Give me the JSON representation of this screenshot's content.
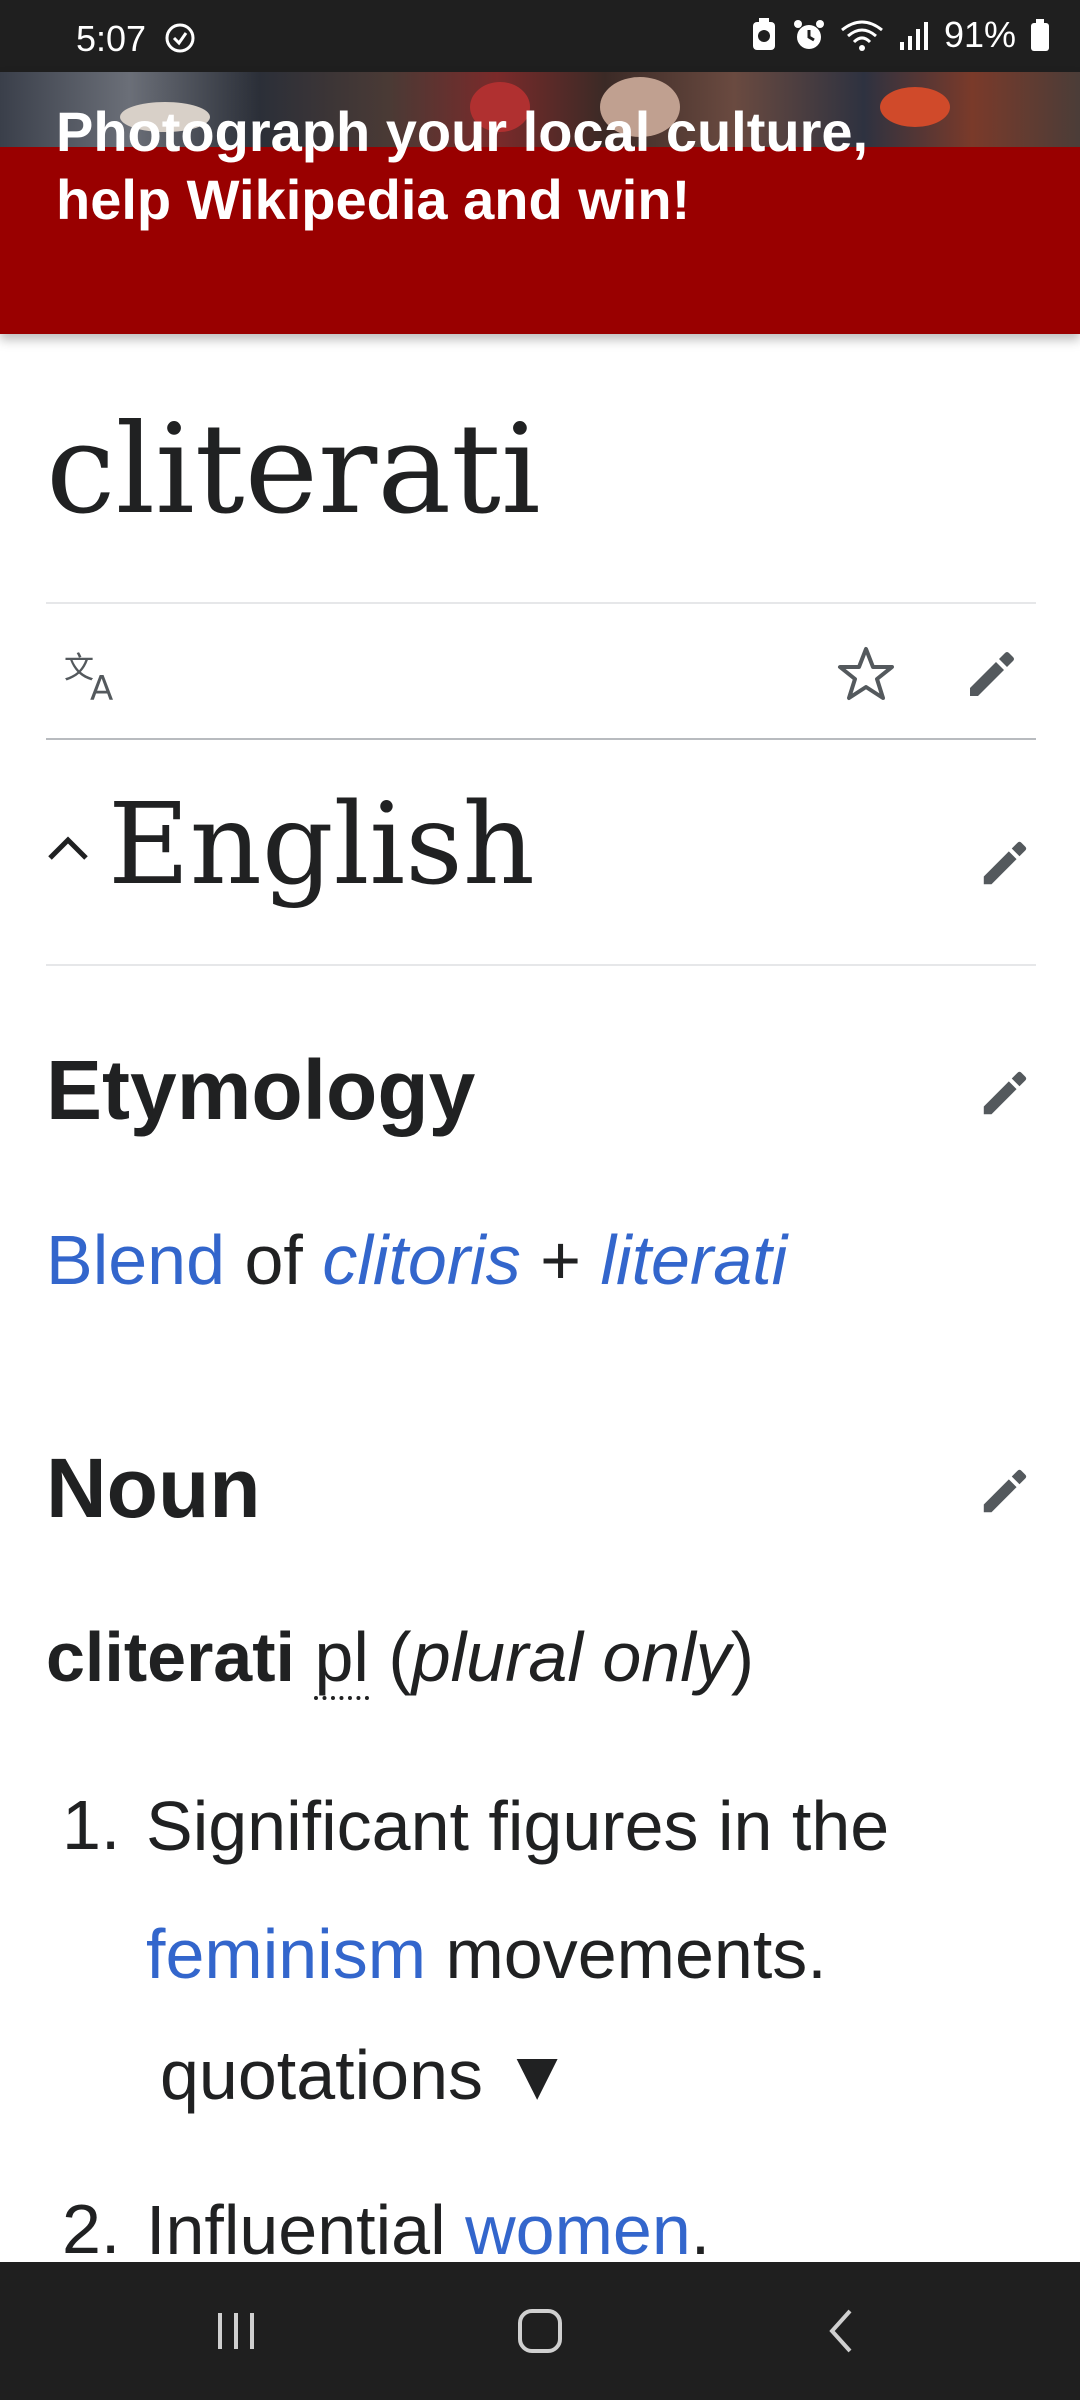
{
  "status_bar": {
    "time": "5:07",
    "battery": "91%"
  },
  "banner": {
    "title_line1": "Photograph your local culture,",
    "title_line2": "help Wikipedia and win!",
    "background_color": "#990000"
  },
  "page": {
    "title": "cliterati"
  },
  "action_bar": {
    "icons": [
      "translate-icon",
      "star-icon",
      "edit-pencil-icon"
    ]
  },
  "section": {
    "language": "English",
    "etymology_heading": "Etymology",
    "etymology": {
      "blend": "Blend",
      "of": "of",
      "word1": "clitoris",
      "plus": "+",
      "word2": "literati"
    },
    "noun_heading": "Noun",
    "headword": {
      "word": "cliterati",
      "abbr": "pl",
      "open_paren": "(",
      "plural_only": "plural only",
      "close_paren": ")"
    },
    "senses": [
      {
        "num": "1.",
        "text_before": "Significant figures in the",
        "link": "feminism",
        "text_after": "movements."
      },
      {
        "num": "2.",
        "text_before": "Influential",
        "link": "women",
        "text_after": "."
      }
    ],
    "quotations_label": "quotations ▼"
  },
  "colors": {
    "link": "#3366cc",
    "text": "#202122",
    "bars": "#1f1f1f"
  }
}
